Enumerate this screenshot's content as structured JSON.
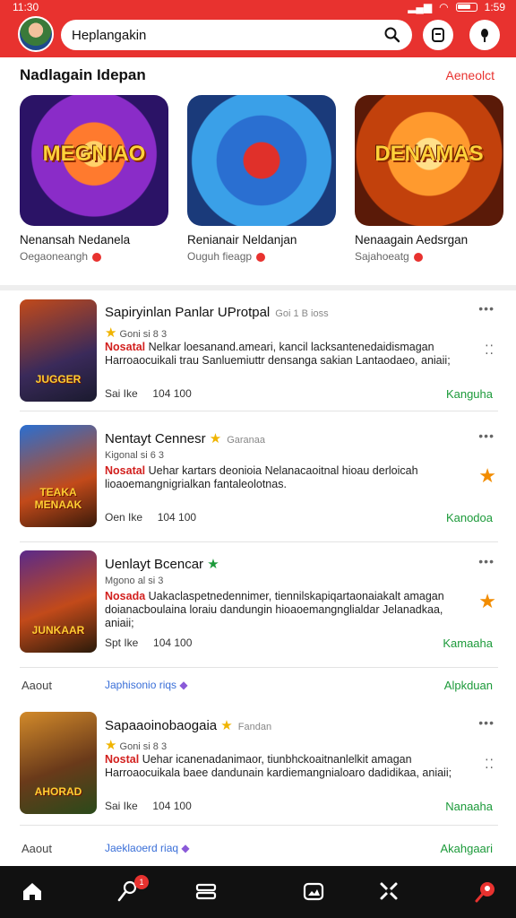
{
  "status_bar": {
    "time": "11:30",
    "battery": "1:59"
  },
  "header": {
    "search_value": "Heplangakin",
    "icons": [
      "avatar",
      "search-icon",
      "bookmark-icon",
      "mic-icon"
    ]
  },
  "featured": {
    "title": "Nadlagain Idepan",
    "see_all": "Aeneolct",
    "cards": [
      {
        "art_title": "MEGNIAO",
        "name": "Nenansah Nedanela",
        "sub": "Oegaoneangh"
      },
      {
        "art_title": "",
        "name": "Renianair Neldanjan",
        "sub": "Ouguh fieagp"
      },
      {
        "art_title": "DENAMAS",
        "name": "Nenaagain Aedsrgan",
        "sub": "Sajahoeatg"
      }
    ]
  },
  "list": [
    {
      "title": "Sapiryinlan Panlar UProtpal",
      "tag": "Goi 1 B ioss",
      "meta": "Goni si 8 3",
      "desc_red": "Nosatal",
      "desc": "Nelkar loesanand.ameari, kancil lacksantenedaidismagan Harroaocuikali trau Sanluemiuttr densanga sakian Lantaodaeo, aniaii;",
      "stat1": "Sai Ike",
      "stat2": "104 100",
      "action": "Kanguha",
      "thumb_label": "JUGGER"
    },
    {
      "title": "Nentayt Cennesr",
      "tag": "Garanaa",
      "meta": "Kigonal si 6 3",
      "desc_red": "Nosatal",
      "desc": "Uehar kartars deonioia Nelanacaoitnal hioau derloicah lioaoemangnigrialkan fantaleolotnas.",
      "stat1": "Oen Ike",
      "stat2": "104 100",
      "action": "Kanodoa",
      "thumb_label": "TEAKA MENAAK"
    },
    {
      "title": "Uenlayt Bcencar",
      "tag": "",
      "meta": "Mgono al si 3",
      "desc_red": "Nosada",
      "desc": "Uakaclaspetnedennimer, tiennilskapiqartaonaiakalt amagan doianacboulaina loraiu dandungin hioaoemangnglialdar Jelanadkaa, aniaii;",
      "stat1": "Spt Ike",
      "stat2": "104 100",
      "action": "Kamaaha",
      "thumb_label": "JUNKAAR"
    },
    {
      "title": "Sapaaoinobaogaia",
      "tag": "Fandan",
      "meta": "Goni si 8 3",
      "desc_red": "Nostal",
      "desc": "Uehar icanenadanimaor, tiunbhckoaitnanlelkit amagan Harroaocuikala baee dandunain kardiemangnialoaro dadidikaa, aniaii;",
      "stat1": "Sai Ike",
      "stat2": "104 100",
      "action": "Nanaaha",
      "thumb_label": "AHORAD"
    }
  ],
  "about_rows": [
    {
      "label": "Aaout",
      "text": "Japhisonio riqs",
      "action": "Alpkduan"
    },
    {
      "label": "Aaout",
      "text": "Jaeklaoerd riaq",
      "action": "Akahgaari"
    }
  ],
  "bottom_nav": {
    "items": [
      "home-icon",
      "search-icon",
      "library-icon",
      "gallery-icon",
      "tools-icon",
      "profile-icon"
    ],
    "badge": "1"
  },
  "colors": {
    "brand": "#e8322f",
    "action": "#1c9a3a",
    "nav_bg": "#111111"
  }
}
